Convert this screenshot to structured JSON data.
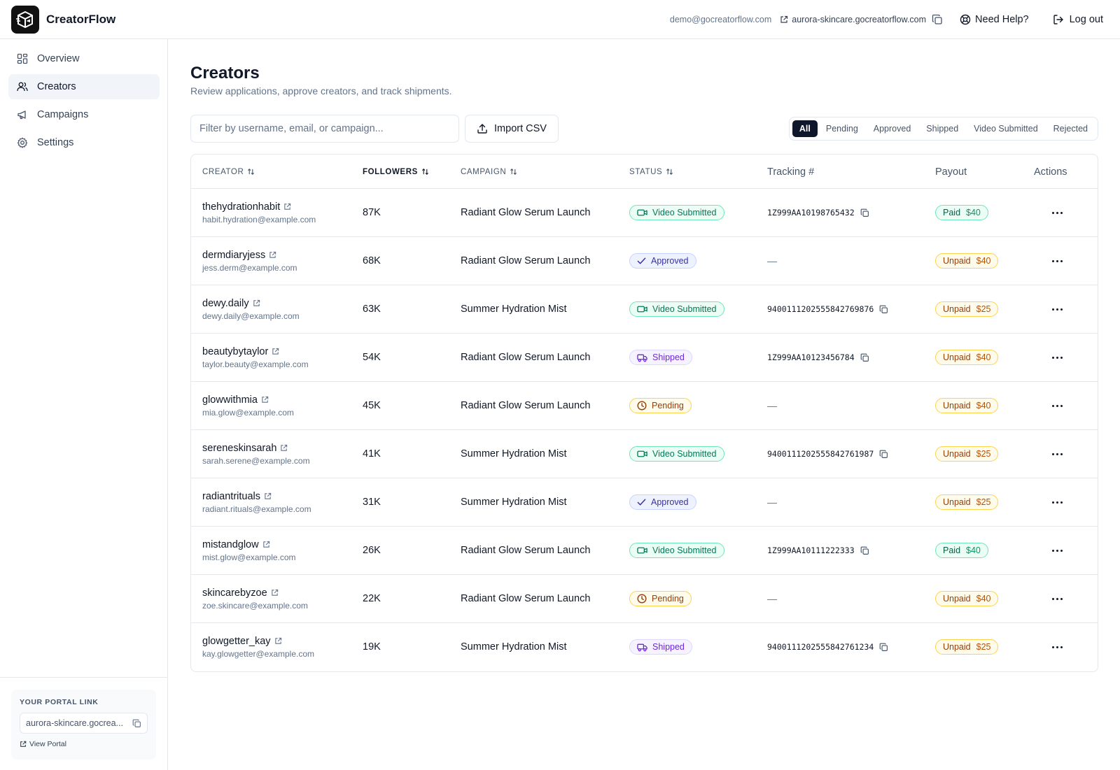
{
  "header": {
    "brand": "CreatorFlow",
    "email": "demo@gocreatorflow.com",
    "portal_url": "aurora-skincare.gocreatorflow.com",
    "help_label": "Need Help?",
    "logout_label": "Log out"
  },
  "sidebar": {
    "items": [
      {
        "label": "Overview",
        "icon": "grid-icon"
      },
      {
        "label": "Creators",
        "icon": "users-icon"
      },
      {
        "label": "Campaigns",
        "icon": "megaphone-icon"
      },
      {
        "label": "Settings",
        "icon": "gear-icon"
      }
    ],
    "active": "Creators",
    "portal": {
      "heading": "YOUR PORTAL LINK",
      "value": "aurora-skincare.gocrea...",
      "view_label": "View Portal"
    }
  },
  "main": {
    "title": "Creators",
    "subtitle": "Review applications, approve creators, and track shipments.",
    "filter_placeholder": "Filter by username, email, or campaign...",
    "import_label": "Import CSV",
    "tabs": [
      "All",
      "Pending",
      "Approved",
      "Shipped",
      "Video Submitted",
      "Rejected"
    ],
    "active_tab": "All"
  },
  "table": {
    "columns": {
      "creator": "CREATOR",
      "followers": "FOLLOWERS",
      "campaign": "CAMPAIGN",
      "status": "STATUS",
      "tracking": "Tracking #",
      "payout": "Payout",
      "actions": "Actions"
    },
    "rows": [
      {
        "handle": "thehydrationhabit",
        "email": "habit.hydration@example.com",
        "followers": "87K",
        "campaign": "Radiant Glow Serum Launch",
        "status": "Video Submitted",
        "tracking": "1Z999AA10198765432",
        "pay_status": "Paid",
        "pay_amount": "$40"
      },
      {
        "handle": "dermdiaryjess",
        "email": "jess.derm@example.com",
        "followers": "68K",
        "campaign": "Radiant Glow Serum Launch",
        "status": "Approved",
        "tracking": "—",
        "pay_status": "Unpaid",
        "pay_amount": "$40"
      },
      {
        "handle": "dewy.daily",
        "email": "dewy.daily@example.com",
        "followers": "63K",
        "campaign": "Summer Hydration Mist",
        "status": "Video Submitted",
        "tracking": "9400111202555842769876",
        "pay_status": "Unpaid",
        "pay_amount": "$25"
      },
      {
        "handle": "beautybytaylor",
        "email": "taylor.beauty@example.com",
        "followers": "54K",
        "campaign": "Radiant Glow Serum Launch",
        "status": "Shipped",
        "tracking": "1Z999AA10123456784",
        "pay_status": "Unpaid",
        "pay_amount": "$40"
      },
      {
        "handle": "glowwithmia",
        "email": "mia.glow@example.com",
        "followers": "45K",
        "campaign": "Radiant Glow Serum Launch",
        "status": "Pending",
        "tracking": "—",
        "pay_status": "Unpaid",
        "pay_amount": "$40"
      },
      {
        "handle": "sereneskinsarah",
        "email": "sarah.serene@example.com",
        "followers": "41K",
        "campaign": "Summer Hydration Mist",
        "status": "Video Submitted",
        "tracking": "9400111202555842761987",
        "pay_status": "Unpaid",
        "pay_amount": "$25"
      },
      {
        "handle": "radiantrituals",
        "email": "radiant.rituals@example.com",
        "followers": "31K",
        "campaign": "Summer Hydration Mist",
        "status": "Approved",
        "tracking": "—",
        "pay_status": "Unpaid",
        "pay_amount": "$25"
      },
      {
        "handle": "mistandglow",
        "email": "mist.glow@example.com",
        "followers": "26K",
        "campaign": "Radiant Glow Serum Launch",
        "status": "Video Submitted",
        "tracking": "1Z999AA10111222333",
        "pay_status": "Paid",
        "pay_amount": "$40"
      },
      {
        "handle": "skincarebyzoe",
        "email": "zoe.skincare@example.com",
        "followers": "22K",
        "campaign": "Radiant Glow Serum Launch",
        "status": "Pending",
        "tracking": "—",
        "pay_status": "Unpaid",
        "pay_amount": "$40"
      },
      {
        "handle": "glowgetter_kay",
        "email": "kay.glowgetter@example.com",
        "followers": "19K",
        "campaign": "Summer Hydration Mist",
        "status": "Shipped",
        "tracking": "9400111202555842761234",
        "pay_status": "Unpaid",
        "pay_amount": "$25"
      }
    ]
  },
  "colors": {
    "brand_dark": "#111111",
    "active_tab": "#0f172a",
    "video_submitted": "#047857",
    "approved": "#3730a3",
    "shipped": "#6d28d9",
    "pending": "#92400e"
  }
}
